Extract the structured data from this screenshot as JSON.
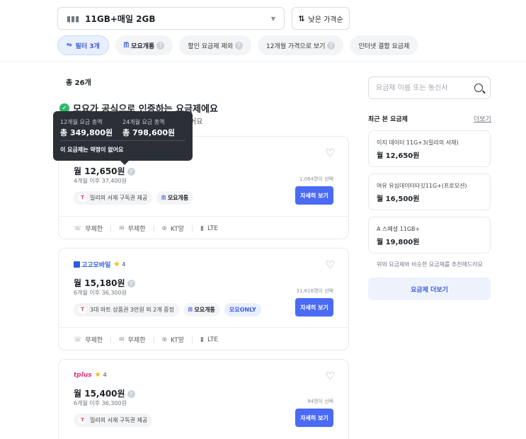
{
  "toolbar": {
    "plan_filter": "11GB+매일 2GB",
    "sort_label": "낮은 가격순"
  },
  "chips": {
    "filter": "필터 3개",
    "moyo": "모요개통",
    "exclude_discount": "할인 요금제 제외",
    "twelve_month": "12개월 가격으로 보기",
    "internet_bundle": "인터넷 결합 요금제"
  },
  "results": {
    "total": "총 26개",
    "certified_title": "모요가 공식으로 인증하는 요금제에요",
    "certified_sub": "어요"
  },
  "tooltip": {
    "label_12": "12개월 요금 총액",
    "value_12": "총 349,800원",
    "label_24": "24개월 요금 총액",
    "value_24": "총 798,600원",
    "note": "이 요금제는 약정이 없어요"
  },
  "plans": [
    {
      "price": "월 12,650원",
      "after": "4개월 이후 37,400원",
      "tag1": "밀리의 서재 구독권 제공",
      "tag2": "모요개통",
      "count": "1,064명이 선택",
      "detail": "자세히 보기",
      "specs": [
        "무제한",
        "무제한",
        "KT망",
        "LTE"
      ]
    },
    {
      "brand": "고고모바일",
      "rating": "4",
      "price": "월 15,180원",
      "after": "6개월 이후 36,300원",
      "tag1": "3대 마트 상품권 3만원 외 2개 증정",
      "tag2": "모요개통",
      "tag3": "모요ONLY",
      "count": "31,818명이 선택",
      "detail": "자세히 보기",
      "specs": [
        "무제한",
        "무제한",
        "KT망",
        "LTE"
      ]
    },
    {
      "brand": "tplus",
      "rating": "4",
      "price": "월 15,400원",
      "after": "6개월 이후 36,300원",
      "tag1": "밀리의 서재 구독권 제공",
      "count": "94명이 선택",
      "detail": "자세히 보기"
    }
  ],
  "sidebar": {
    "search_placeholder": "요금제 이름 또는 통신사",
    "recent_title": "최근 본 요금제",
    "recent_more": "더보기",
    "recent": [
      {
        "name": "이지 데이터 11G+3(밀리의 서재)",
        "price": "월 12,650원"
      },
      {
        "name": "여유 유심데이터타깃11G+(프로모션)",
        "price": "월 16,500원"
      },
      {
        "name": "A 스페셜 11GB+",
        "price": "월 19,800원"
      }
    ],
    "recommend_note": "위의 요금제와 비슷한 요금제를 추천해드려요",
    "more_button": "요금제 더보기"
  },
  "colors": {
    "accent": "#4b6bf5",
    "certified_green": "#2fb86b",
    "tooltip_bg": "#2b3038"
  }
}
